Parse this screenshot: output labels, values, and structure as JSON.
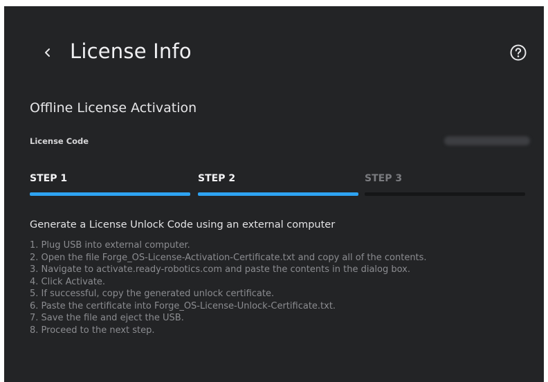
{
  "header": {
    "title": "License Info",
    "back_icon": "chevron-left-icon",
    "help_icon": "question-circle-icon"
  },
  "section": {
    "title": "Offline License Activation",
    "license_code_label": "License Code"
  },
  "steps": [
    {
      "label": "STEP 1",
      "state": "active"
    },
    {
      "label": "STEP 2",
      "state": "active"
    },
    {
      "label": "STEP 3",
      "state": "inactive"
    }
  ],
  "instructions": {
    "title": "Generate a License Unlock Code using an external computer",
    "items": [
      "1. Plug USB into external computer.",
      "2. Open the file Forge_OS-License-Activation-Certificate.txt and copy all of the contents.",
      "3. Navigate to activate.ready-robotics.com and paste the contents in the dialog box.",
      "4. Click Activate.",
      "5. If successful, copy the generated unlock certificate.",
      "6. Paste the certificate into Forge_OS-License-Unlock-Certificate.txt.",
      "7. Save the file and eject the USB.",
      "8. Proceed to the next step."
    ]
  },
  "colors": {
    "background": "#232426",
    "accent": "#2ea3f2",
    "inactive_bar": "#151617",
    "muted_text": "#8b8c90"
  }
}
